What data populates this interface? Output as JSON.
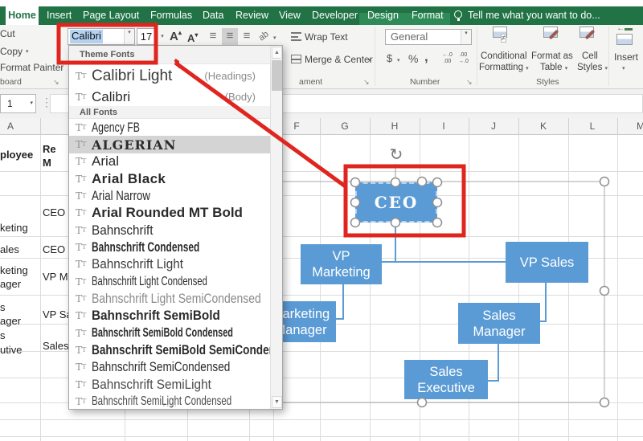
{
  "ribbon_tabs": [
    {
      "label": "Home",
      "active": true
    },
    {
      "label": "Insert"
    },
    {
      "label": "Page Layout"
    },
    {
      "label": "Formulas"
    },
    {
      "label": "Data"
    },
    {
      "label": "Review"
    },
    {
      "label": "View"
    },
    {
      "label": "Developer"
    },
    {
      "label": "Design",
      "contextual": true
    },
    {
      "label": "Format",
      "contextual": true
    }
  ],
  "tell_me": "Tell me what you want to do...",
  "clipboard_group": {
    "cut": "Cut",
    "copy": "Copy",
    "format_painter": "Format Painter",
    "label": "board"
  },
  "font_group": {
    "font_name": "Calibri",
    "font_size": "17"
  },
  "alignment_group": {
    "wrap_text": "Wrap Text",
    "merge_center": "Merge & Center",
    "label": "ament"
  },
  "number_group": {
    "format": "General",
    "label": "Number",
    "dec_inc_top": "←.0",
    "dec_inc_bot": ".00",
    "dec_dec_top": ".00",
    "dec_dec_bot": "→.0"
  },
  "styles_group": {
    "conditional_formatting": [
      "Conditional",
      "Formatting"
    ],
    "format_as_table": [
      "Format as",
      "Table"
    ],
    "cell_styles": [
      "Cell",
      "Styles"
    ],
    "label": "Styles"
  },
  "cells_group": {
    "insert": "Insert"
  },
  "formula_bar": {
    "name_box": "1"
  },
  "font_dropdown": {
    "theme_fonts_header": "Theme Fonts",
    "theme_fonts": [
      {
        "name": "Calibri Light",
        "tag": "(Headings)"
      },
      {
        "name": "Calibri",
        "tag": "(Body)"
      }
    ],
    "all_fonts_header": "All Fonts",
    "all_fonts": [
      "Agency FB",
      "ALGERIAN",
      "Arial",
      "Arial Black",
      "Arial Narrow",
      "Arial Rounded MT Bold",
      "Bahnschrift",
      "Bahnschrift Condensed",
      "Bahnschrift Light",
      "Bahnschrift Light Condensed",
      "Bahnschrift Light SemiCondensed",
      "Bahnschrift SemiBold",
      "Bahnschrift SemiBold Condensed",
      "Bahnschrift SemiBold SemiConden",
      "Bahnschrift SemiCondensed",
      "Bahnschrift SemiLight",
      "Bahnschrift SemiLight Condensed"
    ],
    "highlighted_font": "ALGERIAN"
  },
  "sheet": {
    "column_headers": [
      "A",
      "F",
      "G",
      "H",
      "I",
      "J",
      "K",
      "L",
      "M"
    ],
    "cells": {
      "employee_header": "ployee",
      "reports_header_line1": "Re",
      "reports_header_line2": "M",
      "row3_a": "keting",
      "row3_b": "CEO",
      "row4_a": "ales",
      "row4_b": "CEO",
      "row5_a1": "keting",
      "row5_a2": "ager",
      "row5_b": "VP Ma",
      "row6_a1": "s",
      "row6_a2": "ager",
      "row6_b": "VP Sa",
      "row7_a1": "s",
      "row7_a2": "utive",
      "row7_b": "Sales"
    }
  },
  "org_chart": {
    "nodes": {
      "ceo": "CEO",
      "vp_marketing": "VP Marketing",
      "vp_sales": "VP Sales",
      "marketing_manager": "Marketing Manager",
      "sales_manager": "Sales Manager",
      "sales_executive": "Sales Executive"
    },
    "node_color": "#5b9bd5"
  },
  "annotation": {
    "color": "#e0251f"
  }
}
